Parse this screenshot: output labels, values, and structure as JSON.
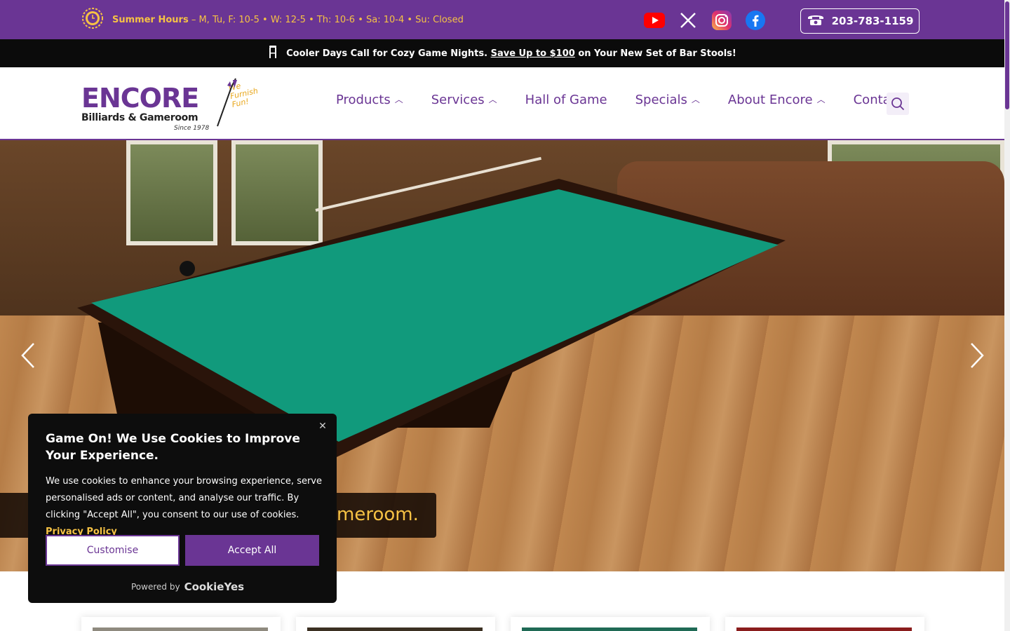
{
  "topbar": {
    "hours_label": "Summer Hours",
    "hours_text": "– M, Tu, F: 10-5 • W: 12-5 • Th: 10-6 • Sa: 10-4 • Su: Closed",
    "phone": "203-783-1159",
    "socials": [
      "youtube-icon",
      "x-icon",
      "instagram-icon",
      "facebook-icon"
    ]
  },
  "promo": {
    "lead": "Cooler Days Call for Cozy Game Nights.",
    "link": "Save Up to $100",
    "tail": "on Your New Set of Bar Stools!"
  },
  "logo": {
    "name": "ENCORE",
    "sub": "Billiards & Gameroom",
    "since": "Since 1978",
    "tag": "We Furnish Fun!"
  },
  "nav": {
    "products": "Products",
    "services": "Services",
    "hall": "Hall of Game",
    "specials": "Specials",
    "about": "About Encore",
    "contact": "Contact"
  },
  "hero": {
    "caption_visible": "meroom."
  },
  "cookie": {
    "title": "Game On! We Use Cookies to Improve Your Experience.",
    "body": "We use cookies to enhance your browsing experience, serve personalised ads or content, and analyse our traffic. By clicking \"Accept All\", you consent to our use of cookies.",
    "privacy_link": "Privacy Policy",
    "customise": "Customise",
    "accept": "Accept All",
    "powered_by": "Powered by",
    "brand": "CookieYes"
  },
  "colors": {
    "brand_purple": "#6a3594",
    "accent_gold": "#f6c244",
    "promo_bg": "#0b0b0b"
  }
}
